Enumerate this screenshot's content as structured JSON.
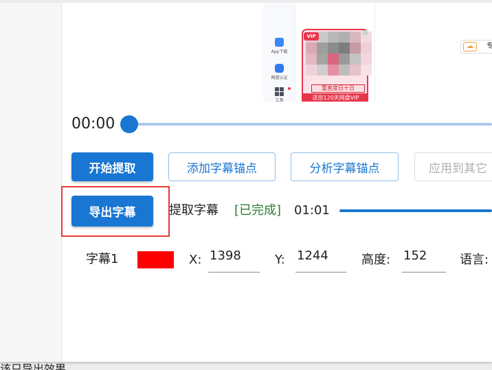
{
  "preview": {
    "sidebar": [
      {
        "label": "App下载",
        "icon": "app-download-icon"
      },
      {
        "label": "网盘认证",
        "icon": "verify-icon"
      },
      {
        "label": "工具",
        "icon": "tools-grid-icon"
      }
    ],
    "banner": {
      "badge": "VIP",
      "line1": "重直度日十日",
      "line2": "送您120天网盘VIP"
    },
    "right_button": {
      "icon": "cloud-icon",
      "label": "专"
    }
  },
  "timeline": {
    "time": "00:00",
    "position": 0
  },
  "actions": {
    "start_label": "开始提取",
    "add_anchor_label": "添加字幕锚点",
    "analyze_anchor_label": "分析字幕锚点",
    "apply_other_label": "应用到其它"
  },
  "export": {
    "button_label": "导出字幕",
    "task_label": "提取字幕",
    "status": "[已完成]",
    "duration": "01:01",
    "progress": 1
  },
  "subtitle": {
    "name": "字幕1",
    "color": "#ff0000",
    "x_label": "X:",
    "x_value": "1398",
    "y_label": "Y:",
    "y_value": "1244",
    "height_label": "高度:",
    "height_value": "152",
    "language_label": "语言:"
  },
  "footer_text": "该只导出效果",
  "colors": {
    "primary": "#1976d2",
    "success": "#2e7d32",
    "highlight_border": "#e53935",
    "slider_track": "#a9c9ee",
    "disabled": "#b0b0b0"
  }
}
